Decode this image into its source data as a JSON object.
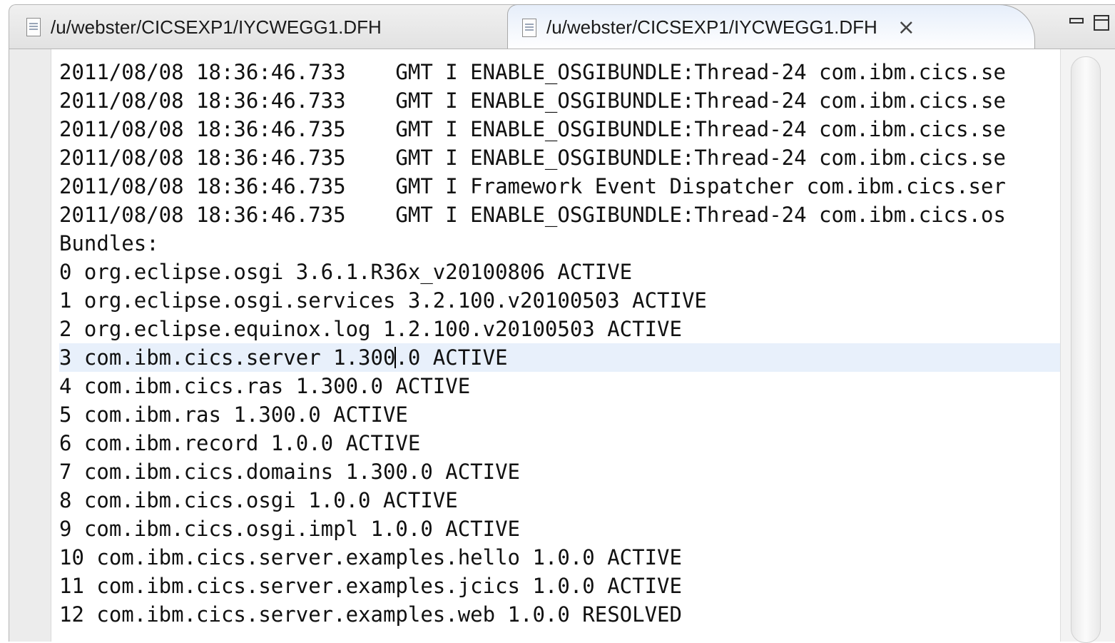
{
  "tabs": [
    {
      "label": "/u/webster/CICSEXP1/IYCWEGG1.DFH",
      "active": false
    },
    {
      "label": "/u/webster/CICSEXP1/IYCWEGG1.DFH",
      "active": true,
      "close": "⨯"
    }
  ],
  "editor": {
    "lines": [
      "2011/08/08 18:36:46.733    GMT I ENABLE_OSGIBUNDLE:Thread-24 com.ibm.cics.se",
      "2011/08/08 18:36:46.733    GMT I ENABLE_OSGIBUNDLE:Thread-24 com.ibm.cics.se",
      "2011/08/08 18:36:46.735    GMT I ENABLE_OSGIBUNDLE:Thread-24 com.ibm.cics.se",
      "2011/08/08 18:36:46.735    GMT I ENABLE_OSGIBUNDLE:Thread-24 com.ibm.cics.se",
      "2011/08/08 18:36:46.735    GMT I Framework Event Dispatcher com.ibm.cics.ser",
      "2011/08/08 18:36:46.735    GMT I ENABLE_OSGIBUNDLE:Thread-24 com.ibm.cics.os",
      "Bundles:",
      "0 org.eclipse.osgi 3.6.1.R36x_v20100806 ACTIVE",
      "1 org.eclipse.osgi.services 3.2.100.v20100503 ACTIVE",
      "2 org.eclipse.equinox.log 1.2.100.v20100503 ACTIVE",
      "3 com.ibm.cics.server 1.300.0 ACTIVE",
      "4 com.ibm.cics.ras 1.300.0 ACTIVE",
      "5 com.ibm.ras 1.300.0 ACTIVE",
      "6 com.ibm.record 1.0.0 ACTIVE",
      "7 com.ibm.cics.domains 1.300.0 ACTIVE",
      "8 com.ibm.cics.osgi 1.0.0 ACTIVE",
      "9 com.ibm.cics.osgi.impl 1.0.0 ACTIVE",
      "10 com.ibm.cics.server.examples.hello 1.0.0 ACTIVE",
      "11 com.ibm.cics.server.examples.jcics 1.0.0 ACTIVE",
      "12 com.ibm.cics.server.examples.web 1.0.0 RESOLVED"
    ],
    "current_line_index": 10,
    "current_line_before_caret": "3 com.ibm.cics.server 1.300",
    "current_line_after_caret": ".0 ACTIVE"
  },
  "icons": {
    "tab_icon": "text-file-icon",
    "minimize": "minimize-icon",
    "maximize": "maximize-icon"
  },
  "colors": {
    "current_line_highlight": "#e8f0fb",
    "active_tab_top": "#e6eefa"
  }
}
